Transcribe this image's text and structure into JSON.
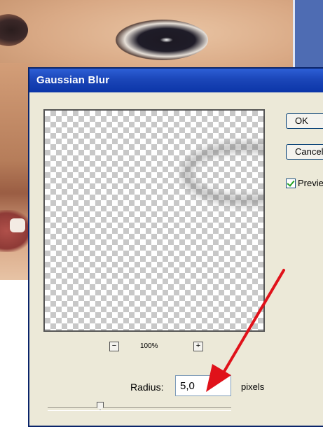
{
  "dialog": {
    "title": "Gaussian Blur",
    "ok_label": "OK",
    "cancel_label": "Cancel",
    "preview_label": "Preview",
    "preview_checked": true,
    "zoom_level": "100%",
    "zoom_out_symbol": "−",
    "zoom_in_symbol": "+",
    "radius_label": "Radius:",
    "radius_value": "5,0",
    "radius_unit": "pixels"
  },
  "colors": {
    "titlebar": "#0b35a8",
    "dialog_bg": "#ece9d8",
    "annotation_arrow": "#e0121a"
  },
  "icons": {
    "zoom_out": "minus-icon",
    "zoom_in": "plus-icon",
    "checkbox": "checkmark-icon"
  }
}
